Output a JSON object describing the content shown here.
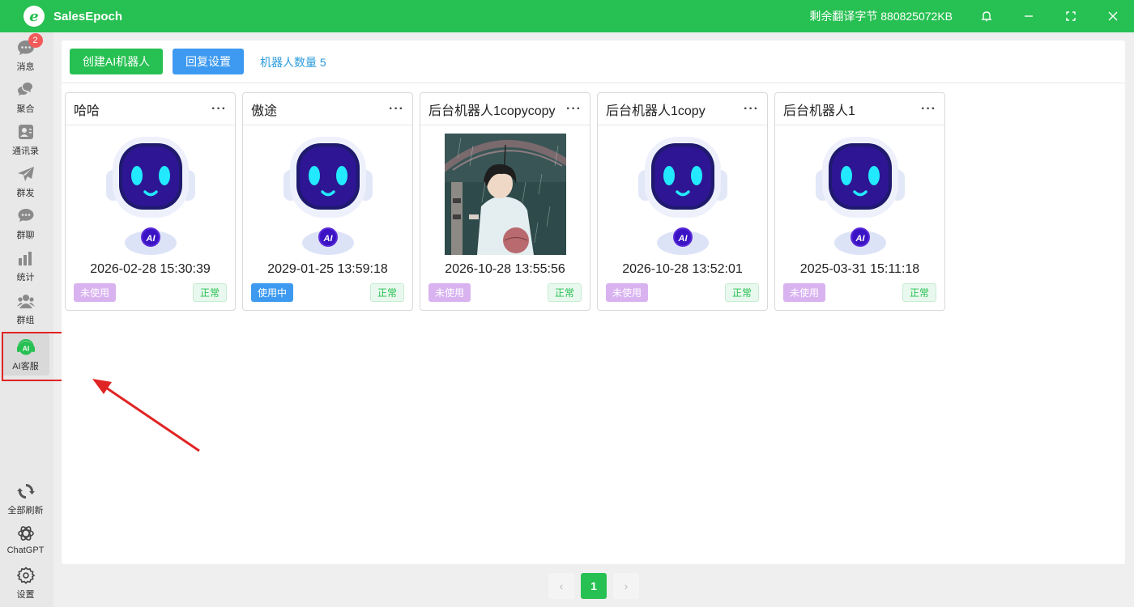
{
  "app": {
    "name": "SalesEpoch",
    "quota_text": "剩余翻译字节 880825072KB"
  },
  "sidebar": {
    "items": [
      {
        "id": "messages",
        "label": "消息",
        "badge": "2"
      },
      {
        "id": "aggregate",
        "label": "聚合"
      },
      {
        "id": "contacts",
        "label": "通讯录"
      },
      {
        "id": "broadcast",
        "label": "群发"
      },
      {
        "id": "group-chat",
        "label": "群聊"
      },
      {
        "id": "stats",
        "label": "统计"
      },
      {
        "id": "groups",
        "label": "群组"
      },
      {
        "id": "ai-service",
        "label": "AI客服"
      }
    ],
    "bottom": [
      {
        "id": "refresh-all",
        "label": "全部刷新"
      },
      {
        "id": "chatgpt",
        "label": "ChatGPT"
      },
      {
        "id": "settings",
        "label": "设置"
      }
    ]
  },
  "toolbar": {
    "create_label": "创建AI机器人",
    "reply_label": "回复设置",
    "count_text": "机器人数量 5"
  },
  "cards": [
    {
      "name": "哈哈",
      "image": "robot-avatar",
      "date": "2026-02-28 15:30:39",
      "usage": "未使用",
      "status": "正常"
    },
    {
      "name": "傲途",
      "image": "robot-avatar",
      "date": "2029-01-25 13:59:18",
      "usage": "使用中",
      "status": "正常"
    },
    {
      "name": "后台机器人1copycopy",
      "image": "anime-boy-rain-photo",
      "date": "2026-10-28 13:55:56",
      "usage": "未使用",
      "status": "正常"
    },
    {
      "name": "后台机器人1copy",
      "image": "robot-avatar",
      "date": "2026-10-28 13:52:01",
      "usage": "未使用",
      "status": "正常"
    },
    {
      "name": "后台机器人1",
      "image": "robot-avatar",
      "date": "2025-03-31 15:11:18",
      "usage": "未使用",
      "status": "正常"
    }
  ],
  "more_glyph": "···",
  "pagination": {
    "prev": "‹",
    "current": "1",
    "next": "›"
  },
  "robot_ai_text": "AI",
  "colors": {
    "brand": "#27c052",
    "blue": "#3d9af0",
    "unused": "#d9b3f0",
    "annotation": "#e02424"
  }
}
